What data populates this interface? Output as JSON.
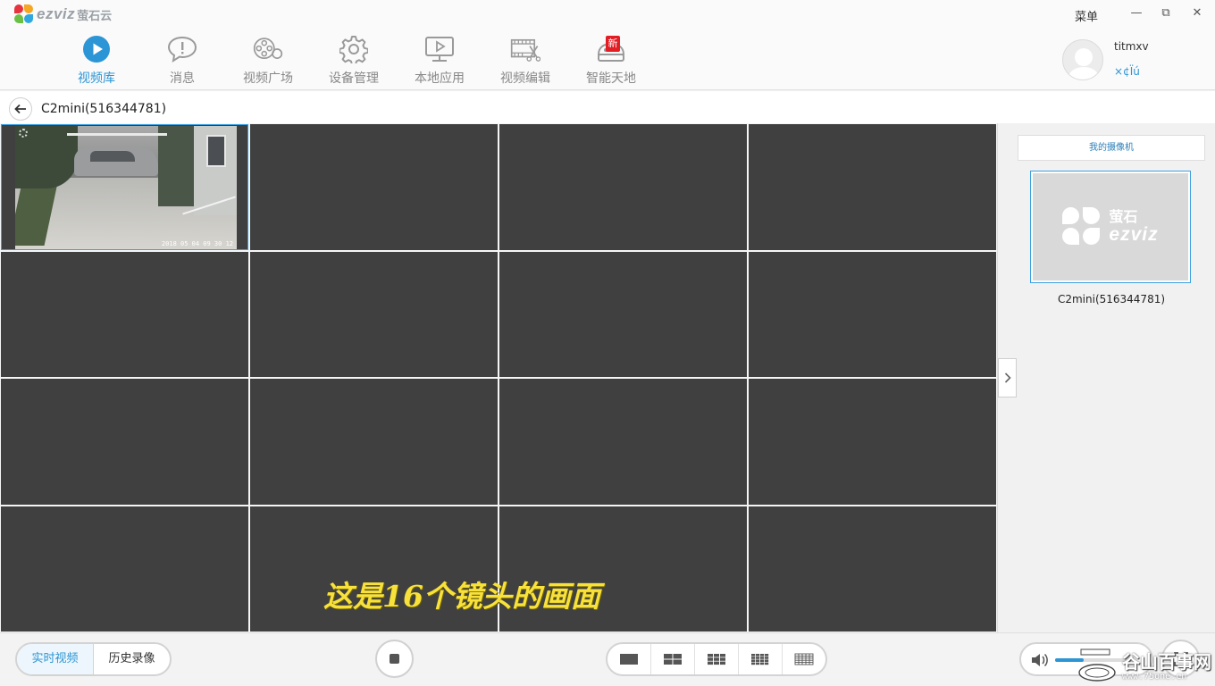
{
  "app": {
    "brand": "ezviz",
    "brand_cn": "萤石云",
    "menu_label": "菜单",
    "window_controls": {
      "minimize": "—",
      "restore": "⧉",
      "close": "✕"
    }
  },
  "nav": [
    {
      "label": "视频库",
      "icon": "play-icon",
      "active": true
    },
    {
      "label": "消息",
      "icon": "message-icon",
      "active": false
    },
    {
      "label": "视频广场",
      "icon": "film-reel-icon",
      "active": false
    },
    {
      "label": "设备管理",
      "icon": "gear-icon",
      "active": false
    },
    {
      "label": "本地应用",
      "icon": "monitor-play-icon",
      "active": false
    },
    {
      "label": "视频编辑",
      "icon": "film-scissors-icon",
      "active": false
    },
    {
      "label": "智能天地",
      "icon": "robot-icon",
      "active": false,
      "badge": "新"
    }
  ],
  "user": {
    "name": "titmxv",
    "subtext": "×¢Ïú"
  },
  "breadcrumb": {
    "title": "C2mini(516344781)"
  },
  "grid": {
    "cells": 16,
    "selected_cell": 1,
    "timestamp": "2018 05 04 09 30 12",
    "caption": "这是16个镜头的画面"
  },
  "side": {
    "tab_label": "我的摄像机",
    "camera": {
      "name": "C2mini(516344781)",
      "logo_cn": "萤石",
      "logo_en": "ezviz"
    }
  },
  "bottom": {
    "modes": [
      "实时视频",
      "历史录像"
    ],
    "active_mode": "实时视频",
    "layouts": [
      "1",
      "4",
      "9",
      "16",
      "25"
    ],
    "volume": 0.4,
    "watermark": {
      "text": "谷山百事网",
      "url": "www.75one.cn"
    }
  },
  "colors": {
    "accent": "#2c95d5",
    "cell_bg": "#404040",
    "caption": "#f7e13a",
    "badge": "#e21d24"
  }
}
